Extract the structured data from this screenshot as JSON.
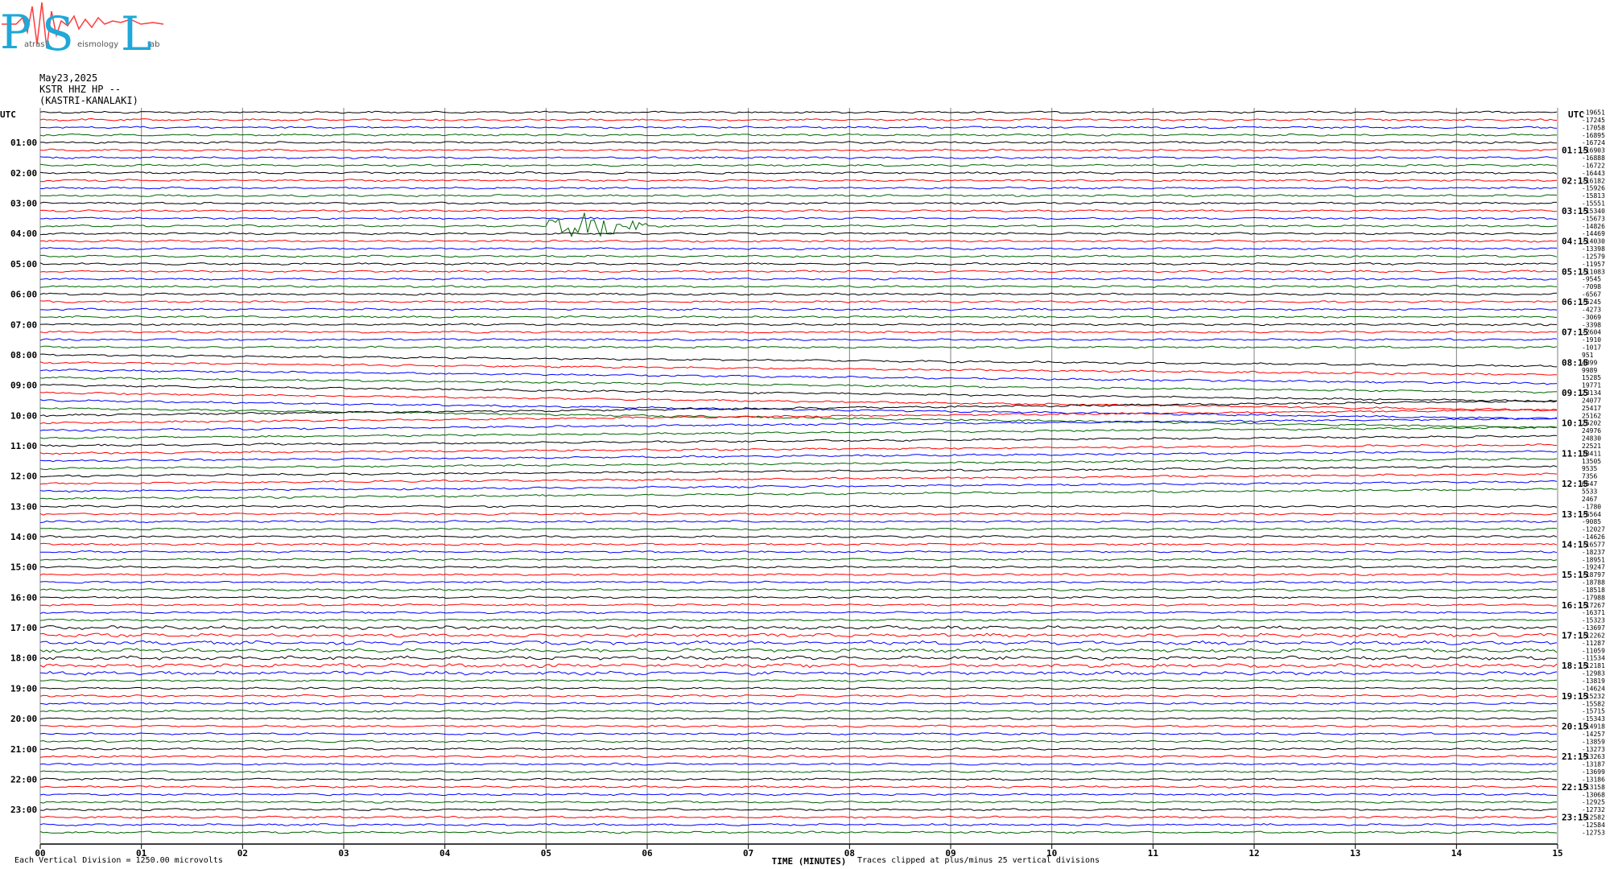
{
  "logo": {
    "letters": [
      "P",
      "S",
      "L"
    ],
    "words": [
      "atras",
      "eismology",
      "ab"
    ]
  },
  "header": {
    "date": "May23,2025",
    "station": "KSTR HHZ HP --",
    "site": "(KASTRI-KANALAKI)"
  },
  "colors": {
    "cycle": [
      "#000000",
      "#ff0000",
      "#0000ff",
      "#006400"
    ],
    "grid": "#808080"
  },
  "chart_data": {
    "type": "line",
    "subtype": "helicorder",
    "left_label": "UTC",
    "right_label": "UTC",
    "left_hours": [
      "01:00",
      "02:00",
      "03:00",
      "04:00",
      "05:00",
      "06:00",
      "07:00",
      "08:00",
      "09:00",
      "10:00",
      "11:00",
      "12:00",
      "13:00",
      "14:00",
      "15:00",
      "16:00",
      "17:00",
      "18:00",
      "19:00",
      "20:00",
      "21:00",
      "22:00",
      "23:00"
    ],
    "right_hours": [
      "01:15",
      "02:15",
      "03:15",
      "04:15",
      "05:15",
      "06:15",
      "07:15",
      "08:15",
      "09:15",
      "10:15",
      "11:15",
      "12:15",
      "13:15",
      "14:15",
      "15:15",
      "16:15",
      "17:15",
      "18:15",
      "19:15",
      "20:15",
      "21:15",
      "22:15",
      "23:15"
    ],
    "x_ticks": [
      "00",
      "01",
      "02",
      "03",
      "04",
      "05",
      "06",
      "07",
      "08",
      "09",
      "10",
      "11",
      "12",
      "13",
      "14",
      "15"
    ],
    "xlim": [
      0,
      15
    ],
    "xlabel": "TIME (MINUTES)",
    "trace_count": 96,
    "minutes_per_line": 15,
    "line_offsets": [
      "-19651",
      "-17245",
      "-17058",
      "-16895",
      "-16724",
      "-16903",
      "-16888",
      "-16722",
      "-16443",
      "-16182",
      "-15926",
      "-15813",
      "-15551",
      "-15340",
      "-15673",
      "-14826",
      "-14469",
      "-14030",
      "-13398",
      "-12579",
      "-11957",
      "-11083",
      "-9545",
      "-7098",
      "-6567",
      "-5245",
      "-4273",
      "-3069",
      "-3398",
      "-2604",
      "-1910",
      "-1017",
      "951",
      "4899",
      "9989",
      "15285",
      "19771",
      "23134",
      "24077",
      "25417",
      "25162",
      "25202",
      "24976",
      "24830",
      "22521",
      "18411",
      "13505",
      "9535",
      "7356",
      "6547",
      "5533",
      "2467",
      "-1780",
      "-5564",
      "-9085",
      "-12027",
      "-14626",
      "-16577",
      "-18237",
      "-18951",
      "-19247",
      "-18797",
      "-18788",
      "-18518",
      "-17988",
      "-17267",
      "-16371",
      "-15323",
      "-13697",
      "-12262",
      "-11287",
      "-11059",
      "-11534",
      "-12181",
      "-12983",
      "-13819",
      "-14624",
      "-15232",
      "-15582",
      "-15715",
      "-15343",
      "-14918",
      "-14257",
      "-13859",
      "-13273",
      "-13263",
      "-13187",
      "-13699",
      "-13186",
      "-13158",
      "-13068",
      "-12925",
      "-12732",
      "-12582",
      "-12584",
      "-12753"
    ],
    "events": [
      {
        "trace": 15,
        "start_min": 5.0,
        "end_min": 6.0,
        "peak_min": 5.45
      }
    ],
    "footer_left": "Each Vertical Division = 1250.00 microvolts",
    "footer_right": "Traces clipped at plus/minus 25 vertical divisions"
  }
}
